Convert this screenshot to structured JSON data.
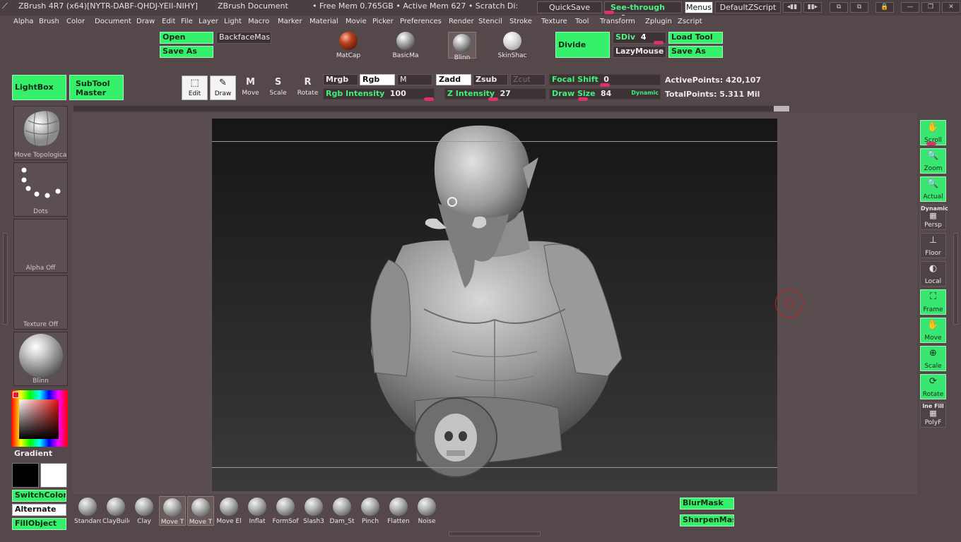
{
  "title_bar": {
    "app": "ZBrush 4R7 (x64)[NYTR-DABF-QHDJ-YEII-NIHY]",
    "document": "ZBrush Document",
    "mem": "• Free Mem 0.765GB • Active Mem 627 • Scratch Di:",
    "quicksave": "QuickSave",
    "see_through": "See-through",
    "see_through_value": "0",
    "menus": "Menus",
    "script": "DefaultZScript"
  },
  "menus": [
    "Alpha",
    "Brush",
    "Color",
    "Document",
    "Draw",
    "Edit",
    "File",
    "Layer",
    "Light",
    "Macro",
    "Marker",
    "Material",
    "Movie",
    "Picker",
    "Preferences",
    "Render",
    "Stencil",
    "Stroke",
    "Texture",
    "Tool",
    "Transform",
    "Zplugin",
    "Zscript"
  ],
  "top_shelf": {
    "open": "Open",
    "save_as": "Save As",
    "backface": "BackfaceMas",
    "materials": [
      {
        "label": "MatCap",
        "icon": "matcap-sphere-icon"
      },
      {
        "label": "BasicMa",
        "icon": "basic-material-sphere-icon"
      },
      {
        "label": "Blinn",
        "icon": "blinn-sphere-icon"
      },
      {
        "label": "SkinShac",
        "icon": "skinshade-sphere-icon"
      }
    ],
    "divide": "Divide",
    "sdiv_label": "SDiv",
    "sdiv_value": "4",
    "lazymouse": "LazyMouse",
    "load_tool": "Load Tool",
    "save_as_tool": "Save As"
  },
  "second_shelf": {
    "lightbox": "LightBox",
    "subtool_master": "SubTool Master",
    "tools": [
      {
        "label": "Edit",
        "glyph": "⬚",
        "icon": "edit-icon"
      },
      {
        "label": "Draw",
        "glyph": "✎",
        "icon": "draw-icon"
      },
      {
        "label": "Move",
        "glyph": "M",
        "icon": "move-icon"
      },
      {
        "label": "Scale",
        "glyph": "S",
        "icon": "scale-icon"
      },
      {
        "label": "Rotate",
        "glyph": "R",
        "icon": "rotate-icon"
      }
    ],
    "mrgb": "Mrgb",
    "rgb": "Rgb",
    "m": "M",
    "zadd": "Zadd",
    "zsub": "Zsub",
    "zcut": "Zcut",
    "rgb_intensity_label": "Rgb Intensity",
    "rgb_intensity_value": "100",
    "z_intensity_label": "Z Intensity",
    "z_intensity_value": "27",
    "focal_shift_label": "Focal Shift",
    "focal_shift_value": "0",
    "draw_size_label": "Draw Size",
    "draw_size_value": "84",
    "dynamic": "Dynamic",
    "active_points": "ActivePoints: 420,107",
    "total_points": "TotalPoints: 5.311 Mil"
  },
  "left_panel": {
    "brush": "Move Topological",
    "stroke": "Dots",
    "alpha": "Alpha Off",
    "texture": "Texture Off",
    "material": "Blinn",
    "gradient": "Gradient",
    "switch_color": "SwitchColor",
    "alternate": "Alternate",
    "fill_object": "FillObject"
  },
  "right_shelf": [
    {
      "label": "Scroll",
      "icon": "hand-scroll-icon",
      "glyph": "✋"
    },
    {
      "label": "Zoom",
      "icon": "zoom-icon",
      "glyph": "🔍"
    },
    {
      "label": "Actual",
      "icon": "actual-icon",
      "glyph": "🔍"
    },
    {
      "label": "Persp",
      "icon": "perspective-icon",
      "glyph": "▦",
      "top_label": "Dynamic"
    },
    {
      "label": "Floor",
      "icon": "floor-icon",
      "glyph": "⊥"
    },
    {
      "label": "Local",
      "icon": "local-icon",
      "glyph": "◐"
    },
    {
      "label": "Frame",
      "icon": "frame-icon",
      "glyph": "⛶"
    },
    {
      "label": "Move",
      "icon": "move-hand-icon",
      "glyph": "✋"
    },
    {
      "label": "Scale",
      "icon": "scale-view-icon",
      "glyph": "⊕"
    },
    {
      "label": "Rotate",
      "icon": "rotate-view-icon",
      "glyph": "⟳"
    },
    {
      "label": "PolyF",
      "icon": "polyframe-icon",
      "glyph": "▦",
      "top_label": "Ine Fill"
    }
  ],
  "bottom_brushes": [
    "Standarc",
    "ClayBuilc",
    "Clay",
    "Move T",
    "Move T",
    "Move El",
    "Inflat",
    "FormSof",
    "Slash3",
    "Dam_St",
    "Pinch",
    "Flatten",
    "Noise"
  ],
  "bottom_right": {
    "blur_mask": "BlurMask",
    "sharpen_mask": "SharpenMask"
  },
  "colors": {
    "accent_green": "#35f06a",
    "slider_pink": "#e0306c",
    "background": "#54484a"
  }
}
